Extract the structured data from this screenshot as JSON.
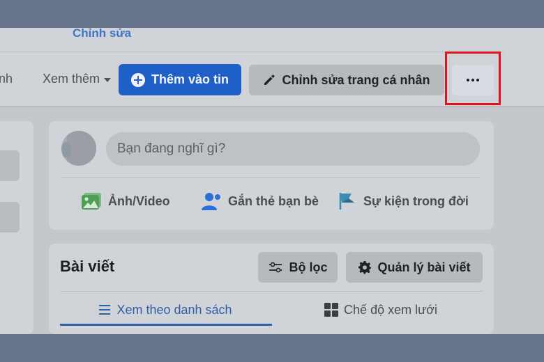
{
  "header": {
    "edit_link": "Chỉnh sửa",
    "nav_partial": "nh",
    "nav_more": "Xem thêm",
    "add_story": "Thêm vào tin",
    "edit_profile": "Chỉnh sửa trang cá nhân"
  },
  "composer": {
    "placeholder": "Bạn đang nghĩ gì?",
    "actions": [
      {
        "label": "Ảnh/Video",
        "icon": "photo-icon",
        "color": "#4f9e57"
      },
      {
        "label": "Gắn thẻ bạn bè",
        "icon": "tag-friends-icon",
        "color": "#2b6fd6"
      },
      {
        "label": "Sự kiện trong đời",
        "icon": "flag-icon",
        "color": "#3a8fb0"
      }
    ]
  },
  "posts": {
    "title": "Bài viết",
    "filter": "Bộ lọc",
    "manage": "Quản lý bài viết",
    "tabs": [
      "Xem theo danh sách",
      "Chế độ xem lưới"
    ]
  },
  "colors": {
    "primary": "#1e60c8",
    "highlight": "#e0141c"
  }
}
